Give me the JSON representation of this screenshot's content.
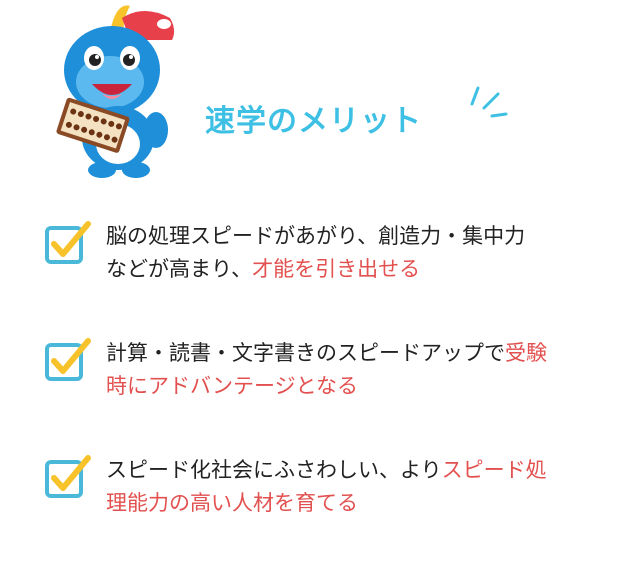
{
  "heading": "速学のメリット",
  "items": [
    {
      "line1": [
        "脳の処理スピードがあがり、創造力・集中力"
      ],
      "line2_plain": "などが高まり、",
      "line2_red": "才能を引き出せる"
    },
    {
      "line1_plain": "計算・読書・文字書きのスピードアップで",
      "line1_red": "受験",
      "line2_red": "時にアドバンテージとなる"
    },
    {
      "line1_plain": "スピード化社会にふさわしい、より",
      "line1_red": "スピード処",
      "line2_red": "理能力の高い人材を育てる"
    }
  ],
  "colors": {
    "heading": "#3ec0e4",
    "accent_red": "#e2504f",
    "check_border": "#4ab9d9",
    "check_mark": "#f7c22a",
    "mascot_blue": "#1e8fd8"
  },
  "icons": {
    "mascot": "blue-dinosaur-mascot-with-abacus-icon",
    "check": "checkbox-checked-icon",
    "sparkle": "sparkle-lines-icon"
  }
}
